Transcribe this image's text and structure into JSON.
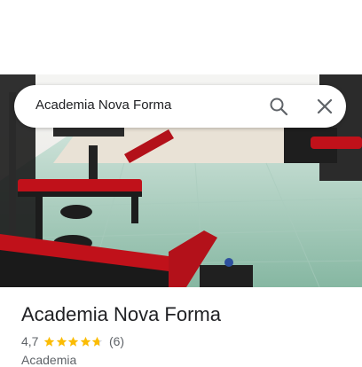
{
  "search": {
    "query": "Academia Nova Forma"
  },
  "place": {
    "name": "Academia Nova Forma",
    "rating": "4,7",
    "rating_value": 4.7,
    "star_count": 5,
    "reviews": "(6)",
    "category": "Academia"
  },
  "icons": {
    "search": "search-icon",
    "close": "close-icon",
    "star": "star-icon"
  },
  "colors": {
    "star": "#fbbc04",
    "text_primary": "#202124",
    "text_secondary": "#5f6368",
    "icon": "#5f6368"
  }
}
